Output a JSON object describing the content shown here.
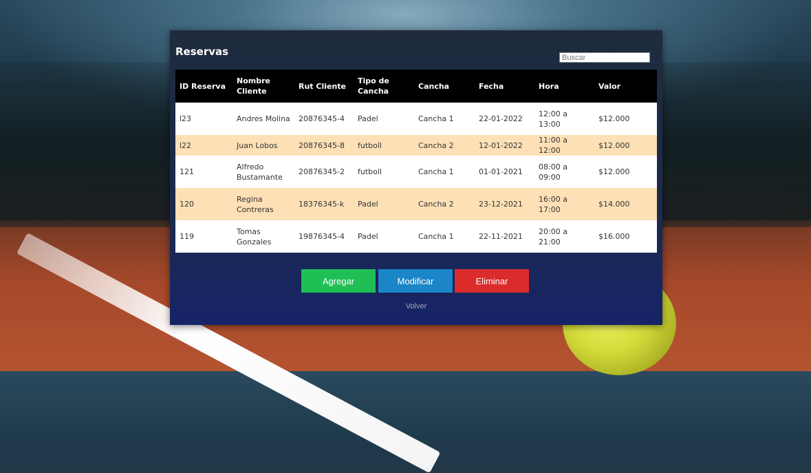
{
  "title": "Reservas",
  "search": {
    "placeholder": "Buscar"
  },
  "table": {
    "headers": [
      "ID Reserva",
      "Nombre Cliente",
      "Rut Cliente",
      "Tipo de Cancha",
      "Cancha",
      "Fecha",
      "Hora",
      "Valor"
    ],
    "rows": [
      [
        "l23",
        "Andres Molina",
        "20876345-4",
        "Padel",
        "Cancha 1",
        "22-01-2022",
        "12:00 a 13:00",
        "$12.000"
      ],
      [
        "l22",
        "Juan Lobos",
        "20876345-8",
        "futboll",
        "Cancha 2",
        "12-01-2022",
        "11:00 a 12:00",
        "$12.000"
      ],
      [
        "121",
        "Alfredo Bustamante",
        "20876345-2",
        "futboll",
        "Cancha 1",
        "01-01-2021",
        "08:00 a 09:00",
        "$12.000"
      ],
      [
        "120",
        "Regina Contreras",
        "18376345-k",
        "Padel",
        "Cancha 2",
        "23-12-2021",
        "16:00 a 17:00",
        "$14.000"
      ],
      [
        "119",
        "Tomas Gonzales",
        "19876345-4",
        "Padel",
        "Cancha 1",
        "22-11-2021",
        "20:00 a 21:00",
        "$16.000"
      ]
    ]
  },
  "buttons": {
    "add": "Agregar",
    "modify": "Modificar",
    "delete": "Eliminar"
  },
  "back_link": "Volver",
  "colors": {
    "header_row": "#000000",
    "row_alt": "#fde0b6",
    "add": "#1fbf56",
    "modify": "#1a86c8",
    "delete": "#dc2b2b"
  }
}
